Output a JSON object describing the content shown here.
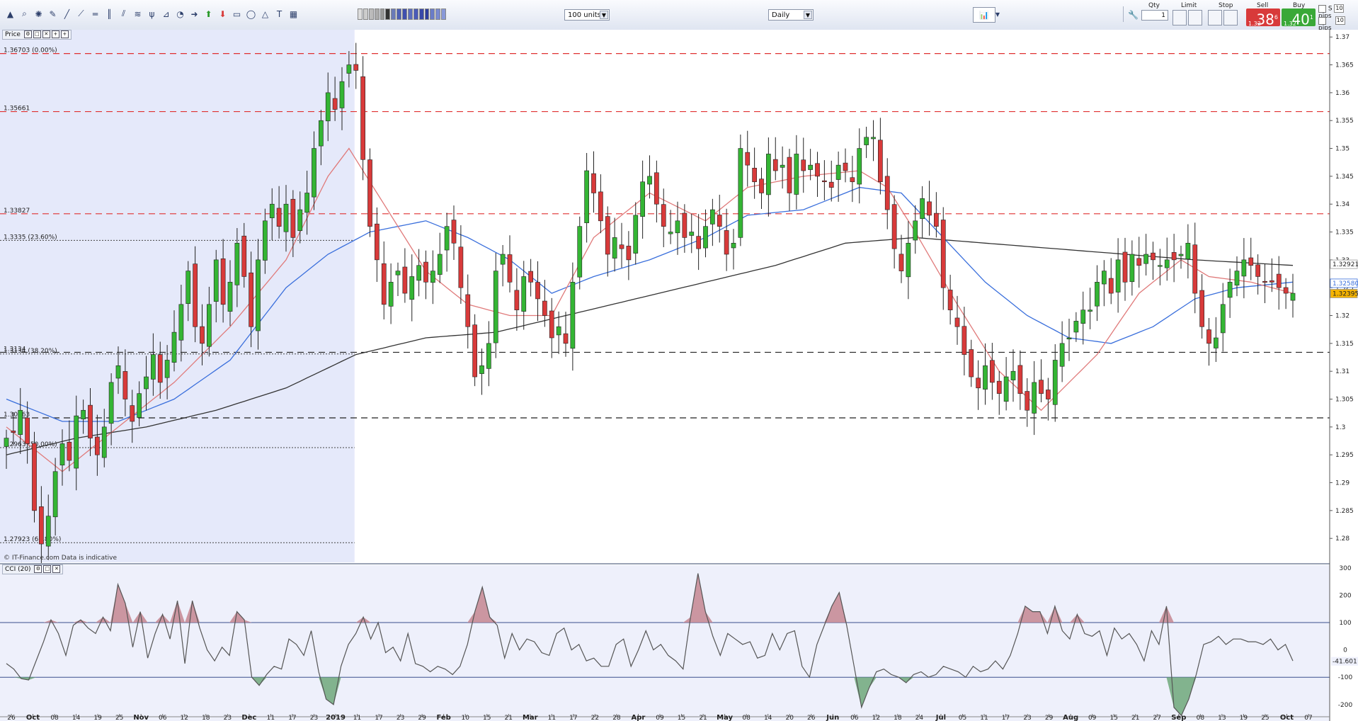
{
  "toolbar": {
    "units_select": "100 units",
    "timeframe_select": "Daily",
    "icons": [
      "pointer-icon",
      "zoom-icon",
      "crosshair-icon",
      "ruler-icon",
      "line-icon",
      "ray-icon",
      "hline-icon",
      "vline-icon",
      "channel-icon",
      "fib-icon",
      "pitchfork-icon",
      "gann-icon",
      "cycle-icon",
      "arrow-icon",
      "up-arrow-icon",
      "down-arrow-icon",
      "rect-icon",
      "ellipse-icon",
      "triangle-icon",
      "text-icon",
      "color-swatch-icon"
    ]
  },
  "trade_panel": {
    "qty_label": "Qty",
    "qty_value": "1",
    "limit_label": "Limit",
    "stop_label": "Stop",
    "sell_label": "Sell",
    "buy_label": "Buy",
    "sell_small": "1.32",
    "sell_big": "38",
    "sell_sup": "6",
    "buy_small": "1.32",
    "buy_big": "40",
    "buy_sup": "1",
    "s_label": "S",
    "pips_label": "pips",
    "pips1_value": "10",
    "pips2_value": "10"
  },
  "price_panel": {
    "label": "Price",
    "watermark": "© IT-Finance.com  Data is indicative"
  },
  "cci_panel": {
    "label": "CCI (20)"
  },
  "colors": {
    "background": "#ffffff",
    "shaded_region": "#e2e7fa",
    "bull_candle": "#34b534",
    "bear_candle": "#d83a3a",
    "ma_fast": "#e07a7a",
    "ma_mid": "#3a6fdc",
    "ma_slow": "#333333",
    "resistance_dash": "#e03030",
    "support_dash": "#222222",
    "cci_line": "#555555",
    "cci_pos_fill": "#c48690",
    "cci_neg_fill": "#6fa87a"
  },
  "chart_data": {
    "type": "candlestick",
    "yaxis_ticks": [
      "1.37",
      "1.365",
      "1.36",
      "1.355",
      "1.35",
      "1.345",
      "1.34",
      "1.335",
      "1.33",
      "1.325",
      "1.32",
      "1.315",
      "1.31",
      "1.305",
      "1.3",
      "1.295",
      "1.29",
      "1.285",
      "1.28"
    ],
    "ylim": [
      1.2757,
      1.3713
    ],
    "x_labels": [
      "26",
      "Oct",
      "08",
      "14",
      "19",
      "25",
      "Nov",
      "06",
      "12",
      "18",
      "23",
      "Dec",
      "11",
      "17",
      "23",
      "2019",
      "11",
      "17",
      "23",
      "29",
      "Feb",
      "10",
      "15",
      "21",
      "Mar",
      "11",
      "17",
      "22",
      "28",
      "Apr",
      "09",
      "15",
      "21",
      "May",
      "08",
      "14",
      "20",
      "26",
      "Jun",
      "06",
      "12",
      "18",
      "24",
      "Jul",
      "05",
      "11",
      "17",
      "23",
      "29",
      "Aug",
      "09",
      "15",
      "21",
      "27",
      "Sep",
      "08",
      "13",
      "19",
      "25",
      "Oct",
      "07"
    ],
    "price_tags": {
      "upper": "1.32921",
      "mid": "1.32580",
      "last": "1.32395"
    },
    "levels": [
      {
        "label": "1.36703 (0.00%)",
        "value": 1.36703,
        "style": "resistance"
      },
      {
        "label": "1.35661",
        "value": 1.35661,
        "style": "resistance"
      },
      {
        "label": "1.33827",
        "value": 1.33827,
        "style": "resistance"
      },
      {
        "label": "1.3335 (23.60%)",
        "value": 1.3335,
        "style": "fib"
      },
      {
        "label": "1.3134",
        "value": 1.3134,
        "style": "support"
      },
      {
        "label": "1.3134 (38.20%)",
        "value": 1.3131,
        "style": "fib"
      },
      {
        "label": "1.30163",
        "value": 1.30163,
        "style": "support"
      },
      {
        "label": "1.2963 (50.00%)",
        "value": 1.2963,
        "style": "fib"
      },
      {
        "label": "1.27923 (61.80%)",
        "value": 1.27923,
        "style": "fib"
      }
    ],
    "anchors": [
      [
        0,
        1.298
      ],
      [
        1,
        1.299
      ],
      [
        2,
        1.303
      ],
      [
        3,
        1.297
      ],
      [
        4,
        1.285
      ],
      [
        5,
        1.279
      ],
      [
        6,
        1.284
      ],
      [
        7,
        1.292
      ],
      [
        8,
        1.297
      ],
      [
        9,
        1.294
      ],
      [
        10,
        1.302
      ],
      [
        11,
        1.303
      ],
      [
        12,
        1.298
      ],
      [
        13,
        1.295
      ],
      [
        14,
        1.3
      ],
      [
        15,
        1.308
      ],
      [
        16,
        1.311
      ],
      [
        17,
        1.305
      ],
      [
        18,
        1.301
      ],
      [
        19,
        1.306
      ],
      [
        20,
        1.309
      ],
      [
        21,
        1.313
      ],
      [
        22,
        1.308
      ],
      [
        23,
        1.312
      ],
      [
        24,
        1.317
      ],
      [
        25,
        1.322
      ],
      [
        26,
        1.328
      ],
      [
        27,
        1.318
      ],
      [
        28,
        1.315
      ],
      [
        29,
        1.322
      ],
      [
        30,
        1.33
      ],
      [
        31,
        1.322
      ],
      [
        32,
        1.326
      ],
      [
        33,
        1.333
      ],
      [
        34,
        1.327
      ],
      [
        35,
        1.318
      ],
      [
        36,
        1.33
      ],
      [
        37,
        1.337
      ],
      [
        38,
        1.34
      ],
      [
        39,
        1.336
      ],
      [
        40,
        1.34
      ],
      [
        41,
        1.334
      ],
      [
        42,
        1.339
      ],
      [
        43,
        1.342
      ],
      [
        44,
        1.35
      ],
      [
        45,
        1.355
      ],
      [
        46,
        1.36
      ],
      [
        47,
        1.357
      ],
      [
        48,
        1.362
      ],
      [
        49,
        1.365
      ],
      [
        50,
        1.364
      ],
      [
        51,
        1.348
      ],
      [
        52,
        1.336
      ],
      [
        53,
        1.33
      ],
      [
        54,
        1.322
      ],
      [
        55,
        1.326
      ],
      [
        56,
        1.328
      ],
      [
        57,
        1.324
      ],
      [
        58,
        1.327
      ],
      [
        59,
        1.329
      ],
      [
        60,
        1.326
      ],
      [
        61,
        1.328
      ],
      [
        62,
        1.331
      ],
      [
        63,
        1.336
      ],
      [
        64,
        1.333
      ],
      [
        65,
        1.325
      ],
      [
        66,
        1.318
      ],
      [
        67,
        1.309
      ],
      [
        68,
        1.311
      ],
      [
        69,
        1.315
      ],
      [
        70,
        1.328
      ],
      [
        71,
        1.331
      ],
      [
        72,
        1.326
      ],
      [
        73,
        1.321
      ],
      [
        74,
        1.327
      ],
      [
        75,
        1.326
      ],
      [
        76,
        1.323
      ],
      [
        77,
        1.32
      ],
      [
        78,
        1.316
      ],
      [
        79,
        1.318
      ],
      [
        80,
        1.315
      ],
      [
        81,
        1.326
      ],
      [
        82,
        1.336
      ],
      [
        83,
        1.346
      ],
      [
        84,
        1.342
      ],
      [
        85,
        1.337
      ],
      [
        86,
        1.331
      ],
      [
        87,
        1.334
      ],
      [
        88,
        1.332
      ],
      [
        89,
        1.33
      ],
      [
        90,
        1.338
      ],
      [
        91,
        1.344
      ],
      [
        92,
        1.345
      ],
      [
        93,
        1.34
      ],
      [
        94,
        1.336
      ],
      [
        95,
        1.335
      ],
      [
        96,
        1.337
      ],
      [
        97,
        1.334
      ],
      [
        98,
        1.335
      ],
      [
        99,
        1.332
      ],
      [
        100,
        1.336
      ],
      [
        101,
        1.339
      ],
      [
        102,
        1.336
      ],
      [
        103,
        1.331
      ],
      [
        104,
        1.333
      ],
      [
        105,
        1.35
      ],
      [
        106,
        1.347
      ],
      [
        107,
        1.344
      ],
      [
        108,
        1.342
      ],
      [
        109,
        1.349
      ],
      [
        110,
        1.346
      ],
      [
        111,
        1.347
      ],
      [
        112,
        1.342
      ],
      [
        113,
        1.349
      ],
      [
        114,
        1.346
      ],
      [
        115,
        1.347
      ],
      [
        116,
        1.345
      ],
      [
        117,
        1.344
      ],
      [
        118,
        1.343
      ],
      [
        119,
        1.347
      ],
      [
        120,
        1.346
      ],
      [
        121,
        1.344
      ],
      [
        122,
        1.35
      ],
      [
        123,
        1.352
      ],
      [
        124,
        1.352
      ],
      [
        125,
        1.344
      ],
      [
        126,
        1.339
      ],
      [
        127,
        1.332
      ],
      [
        128,
        1.328
      ],
      [
        129,
        1.333
      ],
      [
        130,
        1.337
      ],
      [
        131,
        1.341
      ],
      [
        132,
        1.338
      ],
      [
        133,
        1.336
      ],
      [
        134,
        1.325
      ],
      [
        135,
        1.321
      ],
      [
        136,
        1.318
      ],
      [
        137,
        1.313
      ],
      [
        138,
        1.309
      ],
      [
        139,
        1.307
      ],
      [
        140,
        1.311
      ],
      [
        141,
        1.308
      ],
      [
        142,
        1.306
      ],
      [
        143,
        1.309
      ],
      [
        144,
        1.31
      ],
      [
        145,
        1.306
      ],
      [
        146,
        1.303
      ],
      [
        147,
        1.308
      ],
      [
        148,
        1.306
      ],
      [
        149,
        1.305
      ],
      [
        150,
        1.312
      ],
      [
        151,
        1.315
      ],
      [
        152,
        1.316
      ],
      [
        153,
        1.319
      ],
      [
        154,
        1.321
      ],
      [
        155,
        1.321
      ],
      [
        156,
        1.326
      ],
      [
        157,
        1.328
      ],
      [
        158,
        1.324
      ],
      [
        159,
        1.33
      ],
      [
        160,
        1.326
      ],
      [
        161,
        1.331
      ],
      [
        162,
        1.329
      ],
      [
        163,
        1.331
      ],
      [
        164,
        1.33
      ],
      [
        165,
        1.329
      ],
      [
        166,
        1.33
      ],
      [
        167,
        1.33
      ],
      [
        168,
        1.331
      ],
      [
        169,
        1.333
      ],
      [
        170,
        1.324
      ],
      [
        171,
        1.318
      ],
      [
        172,
        1.315
      ],
      [
        173,
        1.316
      ],
      [
        174,
        1.322
      ],
      [
        175,
        1.326
      ],
      [
        176,
        1.328
      ],
      [
        177,
        1.33
      ],
      [
        178,
        1.329
      ],
      [
        179,
        1.327
      ],
      [
        180,
        1.326
      ],
      [
        181,
        1.326
      ],
      [
        182,
        1.325
      ],
      [
        183,
        1.324
      ],
      [
        184,
        1.324
      ]
    ],
    "ma_fast": [
      [
        0,
        1.3
      ],
      [
        8,
        1.292
      ],
      [
        16,
        1.3
      ],
      [
        24,
        1.308
      ],
      [
        32,
        1.318
      ],
      [
        40,
        1.33
      ],
      [
        46,
        1.345
      ],
      [
        49,
        1.35
      ],
      [
        55,
        1.338
      ],
      [
        60,
        1.328
      ],
      [
        66,
        1.322
      ],
      [
        72,
        1.32
      ],
      [
        78,
        1.32
      ],
      [
        84,
        1.334
      ],
      [
        92,
        1.342
      ],
      [
        100,
        1.337
      ],
      [
        106,
        1.343
      ],
      [
        114,
        1.345
      ],
      [
        122,
        1.346
      ],
      [
        126,
        1.343
      ],
      [
        130,
        1.335
      ],
      [
        136,
        1.322
      ],
      [
        142,
        1.31
      ],
      [
        148,
        1.303
      ],
      [
        156,
        1.313
      ],
      [
        162,
        1.324
      ],
      [
        168,
        1.33
      ],
      [
        172,
        1.327
      ],
      [
        178,
        1.326
      ],
      [
        184,
        1.324
      ]
    ],
    "ma_mid": [
      [
        0,
        1.305
      ],
      [
        8,
        1.301
      ],
      [
        16,
        1.301
      ],
      [
        24,
        1.305
      ],
      [
        32,
        1.312
      ],
      [
        40,
        1.325
      ],
      [
        46,
        1.331
      ],
      [
        52,
        1.335
      ],
      [
        60,
        1.337
      ],
      [
        66,
        1.334
      ],
      [
        72,
        1.33
      ],
      [
        78,
        1.324
      ],
      [
        84,
        1.327
      ],
      [
        92,
        1.33
      ],
      [
        100,
        1.334
      ],
      [
        106,
        1.338
      ],
      [
        114,
        1.339
      ],
      [
        122,
        1.343
      ],
      [
        128,
        1.342
      ],
      [
        134,
        1.334
      ],
      [
        140,
        1.326
      ],
      [
        146,
        1.32
      ],
      [
        152,
        1.316
      ],
      [
        158,
        1.315
      ],
      [
        164,
        1.318
      ],
      [
        170,
        1.323
      ],
      [
        176,
        1.325
      ],
      [
        184,
        1.326
      ]
    ],
    "ma_slow": [
      [
        0,
        1.295
      ],
      [
        10,
        1.298
      ],
      [
        20,
        1.3
      ],
      [
        30,
        1.303
      ],
      [
        40,
        1.307
      ],
      [
        50,
        1.313
      ],
      [
        60,
        1.316
      ],
      [
        70,
        1.317
      ],
      [
        80,
        1.32
      ],
      [
        90,
        1.323
      ],
      [
        100,
        1.326
      ],
      [
        110,
        1.329
      ],
      [
        120,
        1.333
      ],
      [
        130,
        1.334
      ],
      [
        140,
        1.333
      ],
      [
        150,
        1.332
      ],
      [
        160,
        1.331
      ],
      [
        170,
        1.33
      ],
      [
        184,
        1.329
      ]
    ],
    "cci": {
      "label": "CCI (20)",
      "yaxis_ticks": [
        "300",
        "200",
        "100",
        "0",
        "-41.601",
        "-100",
        "-200"
      ],
      "ylim": [
        -260,
        310
      ],
      "last_value": "-41.601",
      "values": [
        -50,
        -70,
        -105,
        -110,
        -40,
        30,
        110,
        60,
        -20,
        90,
        110,
        80,
        60,
        120,
        70,
        240,
        170,
        10,
        140,
        -30,
        60,
        130,
        40,
        180,
        -50,
        180,
        80,
        0,
        -40,
        10,
        -20,
        140,
        110,
        -100,
        -130,
        -90,
        -60,
        -70,
        40,
        20,
        -20,
        70,
        -80,
        -180,
        -200,
        -60,
        20,
        60,
        120,
        40,
        100,
        -10,
        10,
        -40,
        60,
        -50,
        -60,
        -80,
        -60,
        -70,
        -90,
        -60,
        20,
        140,
        230,
        120,
        90,
        -30,
        60,
        0,
        40,
        30,
        -10,
        -20,
        60,
        80,
        0,
        20,
        -40,
        -30,
        -60,
        -60,
        20,
        40,
        -60,
        0,
        70,
        0,
        20,
        -20,
        -40,
        -70,
        120,
        280,
        140,
        50,
        -20,
        60,
        40,
        20,
        30,
        -30,
        -20,
        60,
        0,
        60,
        70,
        -60,
        -100,
        20,
        90,
        160,
        210,
        90,
        -60,
        -210,
        -140,
        -80,
        -70,
        -90,
        -100,
        -120,
        -90,
        -80,
        -100,
        -90,
        -60,
        -70,
        -80,
        -100,
        -60,
        -80,
        -70,
        -40,
        -70,
        -20,
        60,
        160,
        140,
        140,
        60,
        160,
        70,
        40,
        130,
        60,
        50,
        70,
        -20,
        80,
        40,
        60,
        20,
        -40,
        70,
        20,
        160,
        -210,
        -240,
        -180,
        -90,
        20,
        30,
        50,
        20,
        40,
        40,
        30,
        30,
        20,
        40,
        0,
        20,
        -40
      ]
    }
  }
}
